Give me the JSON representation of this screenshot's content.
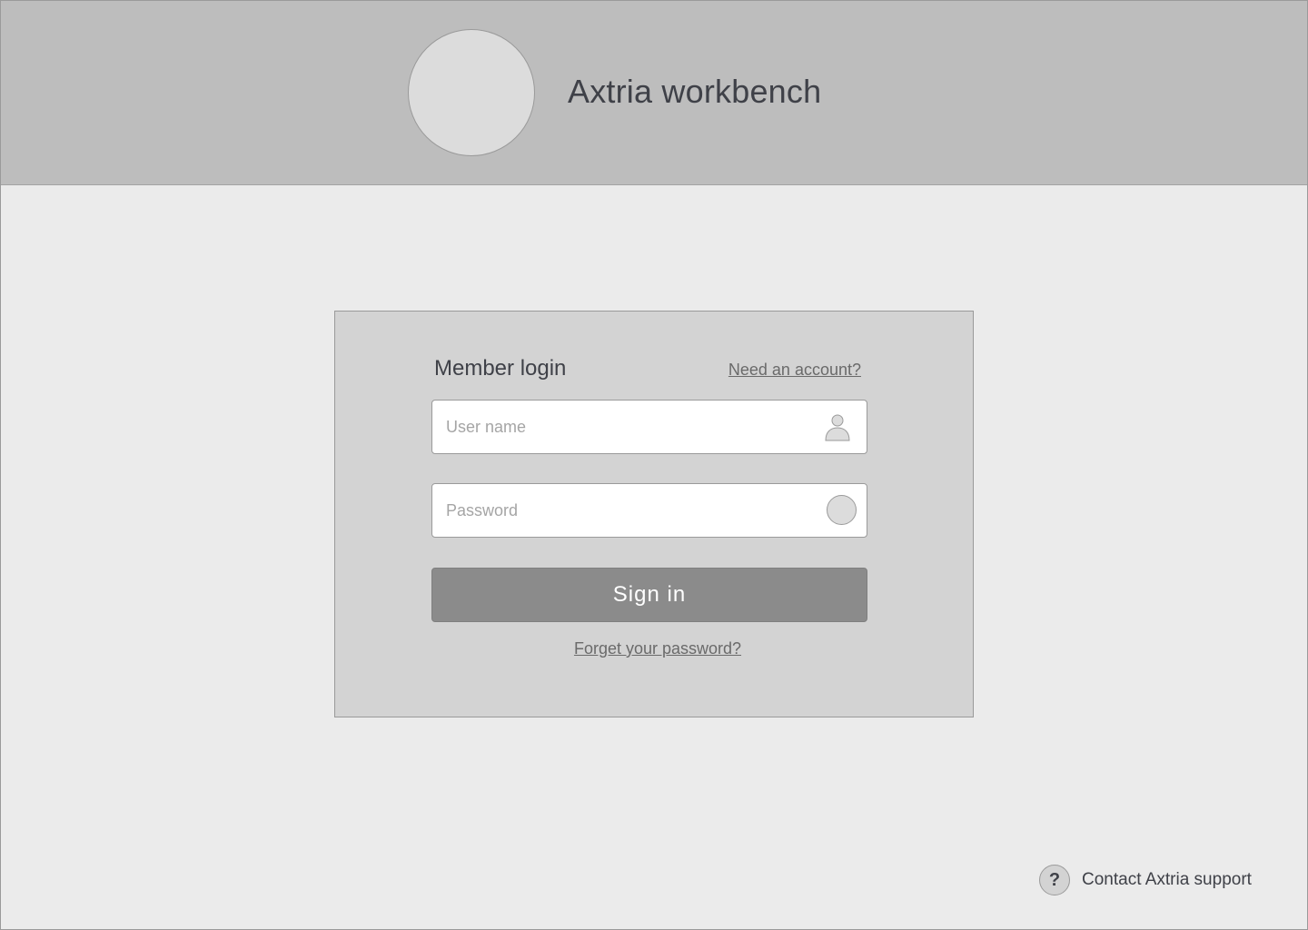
{
  "header": {
    "app_title": "Axtria workbench"
  },
  "login": {
    "title": "Member login",
    "need_account_link": "Need an account?",
    "username_placeholder": "User name",
    "username_value": "",
    "password_placeholder": "Password",
    "password_value": "",
    "signin_label": "Sign in",
    "forgot_link": "Forget your password?"
  },
  "footer": {
    "help_icon_glyph": "?",
    "support_label": "Contact Axtria support"
  },
  "icons": {
    "logo": "logo-placeholder-icon",
    "user": "user-icon",
    "password": "lock-icon",
    "help": "help-icon"
  },
  "colors": {
    "header_bg": "#bdbdbd",
    "page_bg": "#ebebeb",
    "card_bg": "#d3d3d3",
    "button_bg": "#8b8b8b",
    "text": "#3f4148",
    "link": "#6a6a6a"
  }
}
